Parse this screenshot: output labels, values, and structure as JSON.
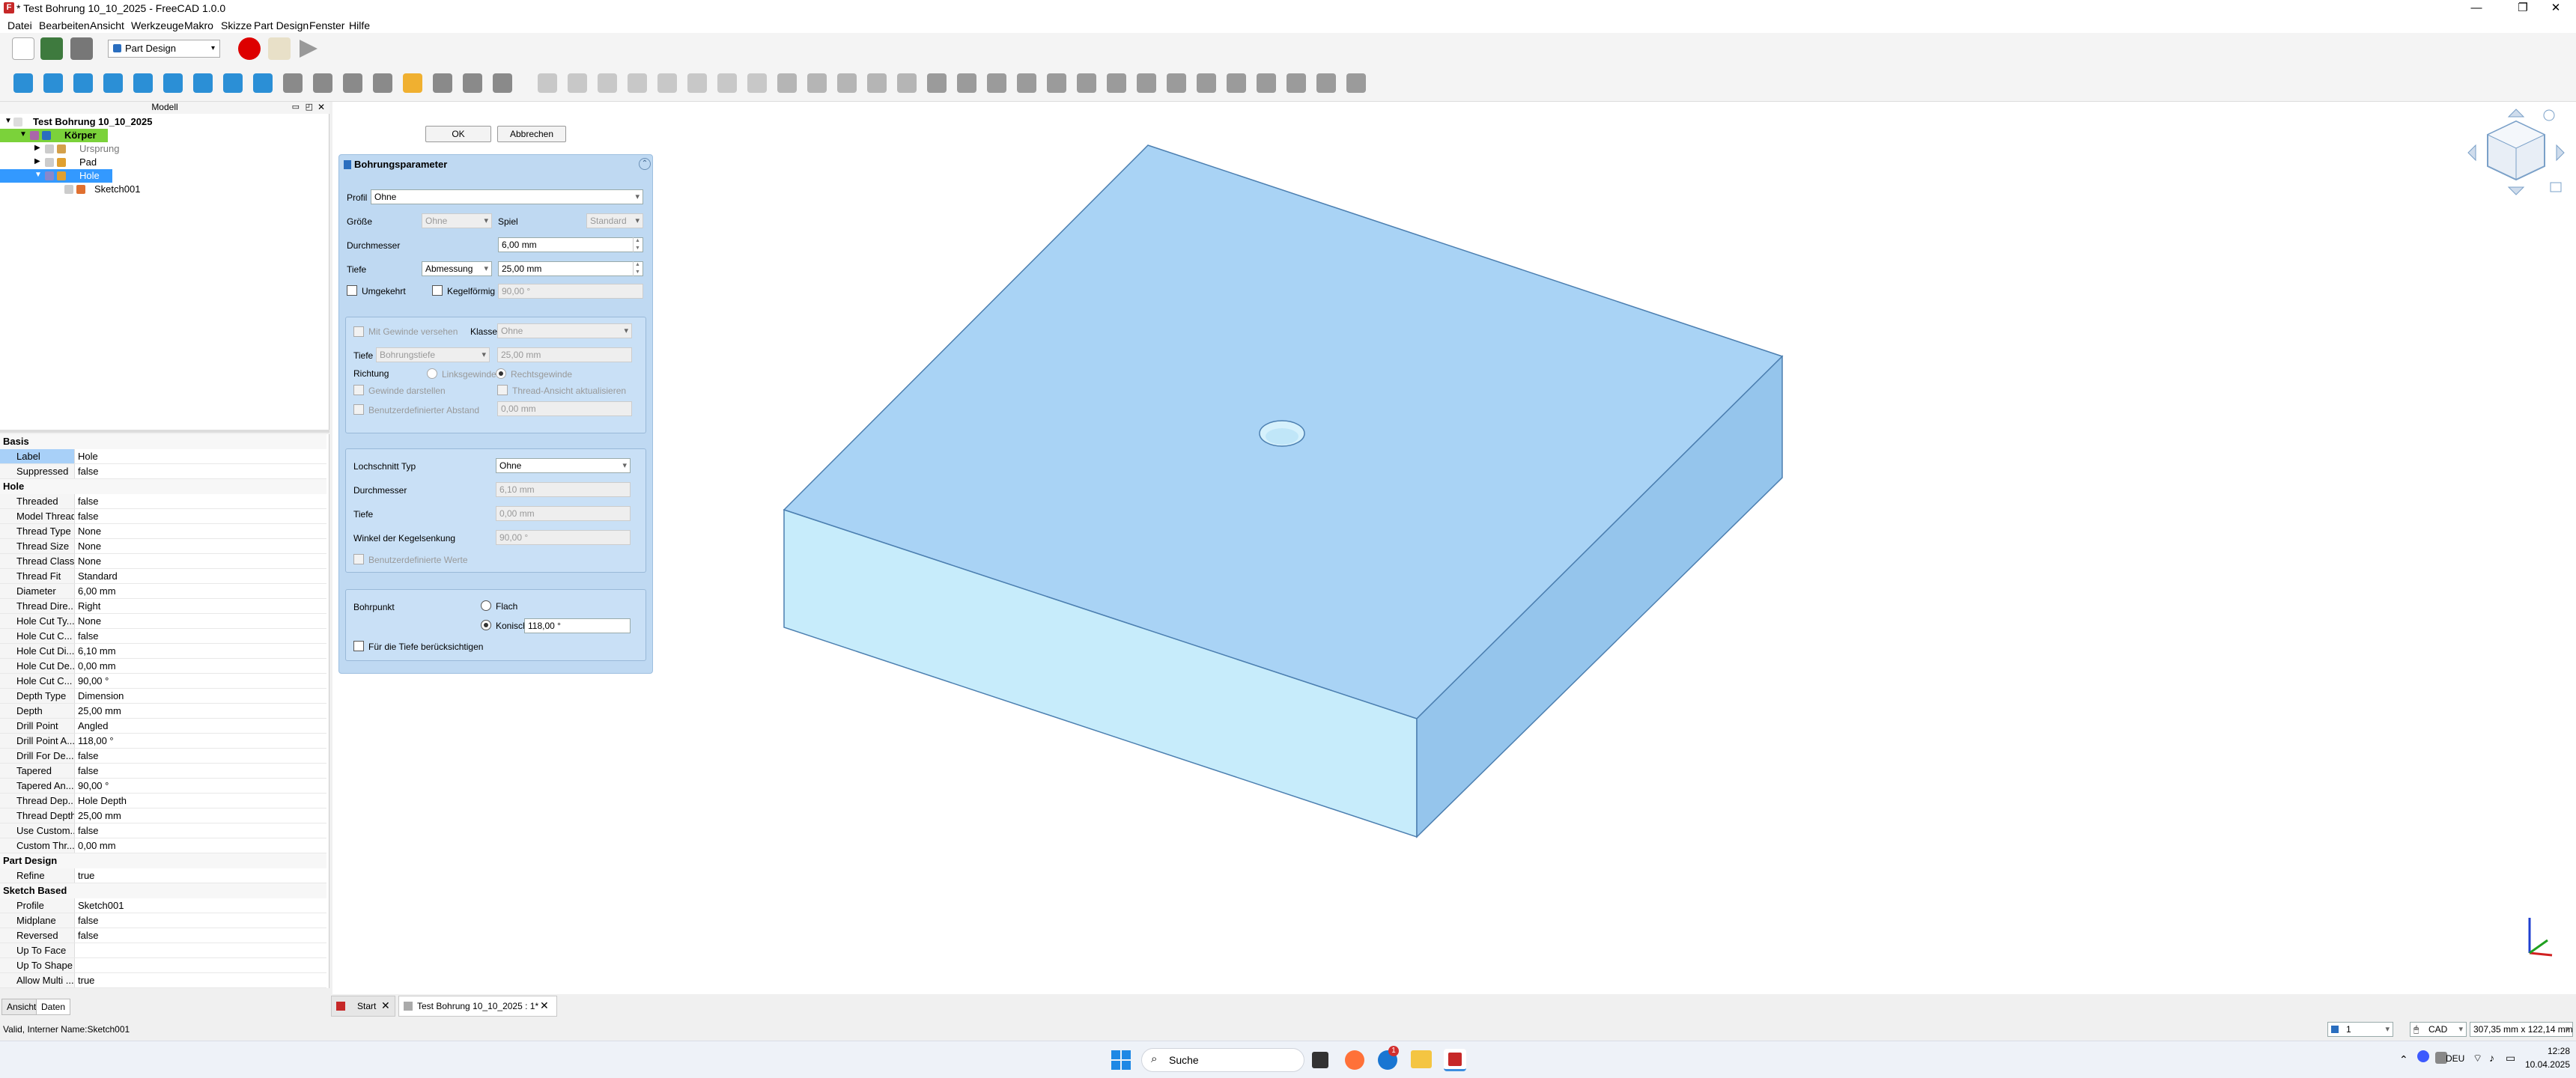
{
  "window": {
    "title": "* Test Bohrung 10_10_2025 - FreeCAD 1.0.0",
    "controls": [
      "—",
      "❐",
      "✕"
    ]
  },
  "menu": [
    "Datei",
    "Bearbeiten",
    "Ansicht",
    "Werkzeuge",
    "Makro",
    "Skizze",
    "Part Design",
    "Fenster",
    "Hilfe"
  ],
  "workbench": "Part Design",
  "tree": {
    "header": "Modell",
    "items": [
      {
        "label": "Test Bohrung 10_10_2025",
        "level": 0
      },
      {
        "label": "Körper",
        "level": 1
      },
      {
        "label": "Ursprung",
        "level": 2
      },
      {
        "label": "Pad",
        "level": 2
      },
      {
        "label": "Hole",
        "level": 2
      },
      {
        "label": "Sketch001",
        "level": 3
      }
    ]
  },
  "properties": {
    "groups": [
      {
        "name": "Basis",
        "rows": [
          {
            "name": "Label",
            "value": "Hole"
          },
          {
            "name": "Suppressed",
            "value": "false"
          }
        ]
      },
      {
        "name": "Hole",
        "rows": [
          {
            "name": "Threaded",
            "value": "false"
          },
          {
            "name": "Model Thread",
            "value": "false"
          },
          {
            "name": "Thread Type",
            "value": "None"
          },
          {
            "name": "Thread Size",
            "value": "None"
          },
          {
            "name": "Thread Class",
            "value": "None"
          },
          {
            "name": "Thread Fit",
            "value": "Standard"
          },
          {
            "name": "Diameter",
            "value": "6,00 mm"
          },
          {
            "name": "Thread Dire...",
            "value": "Right"
          },
          {
            "name": "Hole Cut Ty...",
            "value": "None"
          },
          {
            "name": "Hole Cut C...",
            "value": "false"
          },
          {
            "name": "Hole Cut Di...",
            "value": "6,10 mm"
          },
          {
            "name": "Hole Cut De...",
            "value": "0,00 mm"
          },
          {
            "name": "Hole Cut C...",
            "value": "90,00 °"
          },
          {
            "name": "Depth Type",
            "value": "Dimension"
          },
          {
            "name": "Depth",
            "value": "25,00 mm"
          },
          {
            "name": "Drill Point",
            "value": "Angled"
          },
          {
            "name": "Drill Point A...",
            "value": "118,00 °"
          },
          {
            "name": "Drill For De...",
            "value": "false"
          },
          {
            "name": "Tapered",
            "value": "false"
          },
          {
            "name": "Tapered An...",
            "value": "90,00 °"
          },
          {
            "name": "Thread Dep...",
            "value": "Hole Depth"
          },
          {
            "name": "Thread Depth",
            "value": "25,00 mm"
          },
          {
            "name": "Use Custom...",
            "value": "false"
          },
          {
            "name": "Custom Thr...",
            "value": "0,00 mm"
          }
        ]
      },
      {
        "name": "Part Design",
        "rows": [
          {
            "name": "Refine",
            "value": "true"
          }
        ]
      },
      {
        "name": "Sketch Based",
        "rows": [
          {
            "name": "Profile",
            "value": "Sketch001"
          },
          {
            "name": "Midplane",
            "value": "false"
          },
          {
            "name": "Reversed",
            "value": "false"
          },
          {
            "name": "Up To Face",
            "value": ""
          },
          {
            "name": "Up To Shape",
            "value": ""
          },
          {
            "name": "Allow Multi ...",
            "value": "true"
          }
        ]
      }
    ],
    "tabs": [
      "Ansicht",
      "Daten"
    ]
  },
  "task": {
    "ok": "OK",
    "cancel": "Abbrechen",
    "title": "Bohrungsparameter",
    "profil_label": "Profil",
    "profil_value": "Ohne",
    "groesse_label": "Größe",
    "groesse_value": "Ohne",
    "spiel_label": "Spiel",
    "spiel_value": "Standard",
    "durchmesser_label": "Durchmesser",
    "durchmesser_value": "6,00 mm",
    "tiefe_label": "Tiefe",
    "tiefe_type": "Abmessung",
    "tiefe_value": "25,00 mm",
    "umgekehrt": "Umgekehrt",
    "kegelfoermig": "Kegelförmig",
    "kegel_value": "90,00 °",
    "gewinde": {
      "mit_gewinde": "Mit Gewinde versehen",
      "klasse_label": "Klasse",
      "klasse_value": "Ohne",
      "tiefe_label": "Tiefe",
      "tiefe_type": "Bohrungstiefe",
      "tiefe_value": "25,00 mm",
      "richtung": "Richtung",
      "links": "Linksgewinde",
      "rechts": "Rechtsgewinde",
      "darstellen": "Gewinde darstellen",
      "ansicht": "Thread-Ansicht aktualisieren",
      "abstand": "Benutzerdefinierter Abstand",
      "abstand_value": "0,00 mm"
    },
    "senkung": {
      "typ_label": "Lochschnitt Typ",
      "typ_value": "Ohne",
      "durchmesser_label": "Durchmesser",
      "durchmesser_value": "6,10 mm",
      "tiefe_label": "Tiefe",
      "tiefe_value": "0,00 mm",
      "winkel_label": "Winkel der Kegelsenkung",
      "winkel_value": "90,00 °",
      "benutzer": "Benutzerdefinierte Werte"
    },
    "bohrpunkt": {
      "label": "Bohrpunkt",
      "flach": "Flach",
      "konisch": "Konisch",
      "winkel": "118,00 °",
      "tiefe_check": "Für die Tiefe berücksichtigen"
    }
  },
  "doc_tabs": [
    "Start",
    "Test Bohrung 10_10_2025 : 1*"
  ],
  "status": {
    "message": "Valid, Interner Name:Sketch001",
    "page": "1",
    "nav": "CAD",
    "dims": "307,35 mm x 122,14 mm"
  },
  "taskbar": {
    "search": "Suche",
    "lang": "DEU",
    "time": "12:28",
    "date": "10.04.2025",
    "badge": "1"
  },
  "colors": {
    "accent": "#3399ff",
    "task_bg": "#bfd9f2",
    "solid_top": "#a9d3f5",
    "solid_front": "#c7ecfb",
    "solid_side": "#95c5ec"
  }
}
